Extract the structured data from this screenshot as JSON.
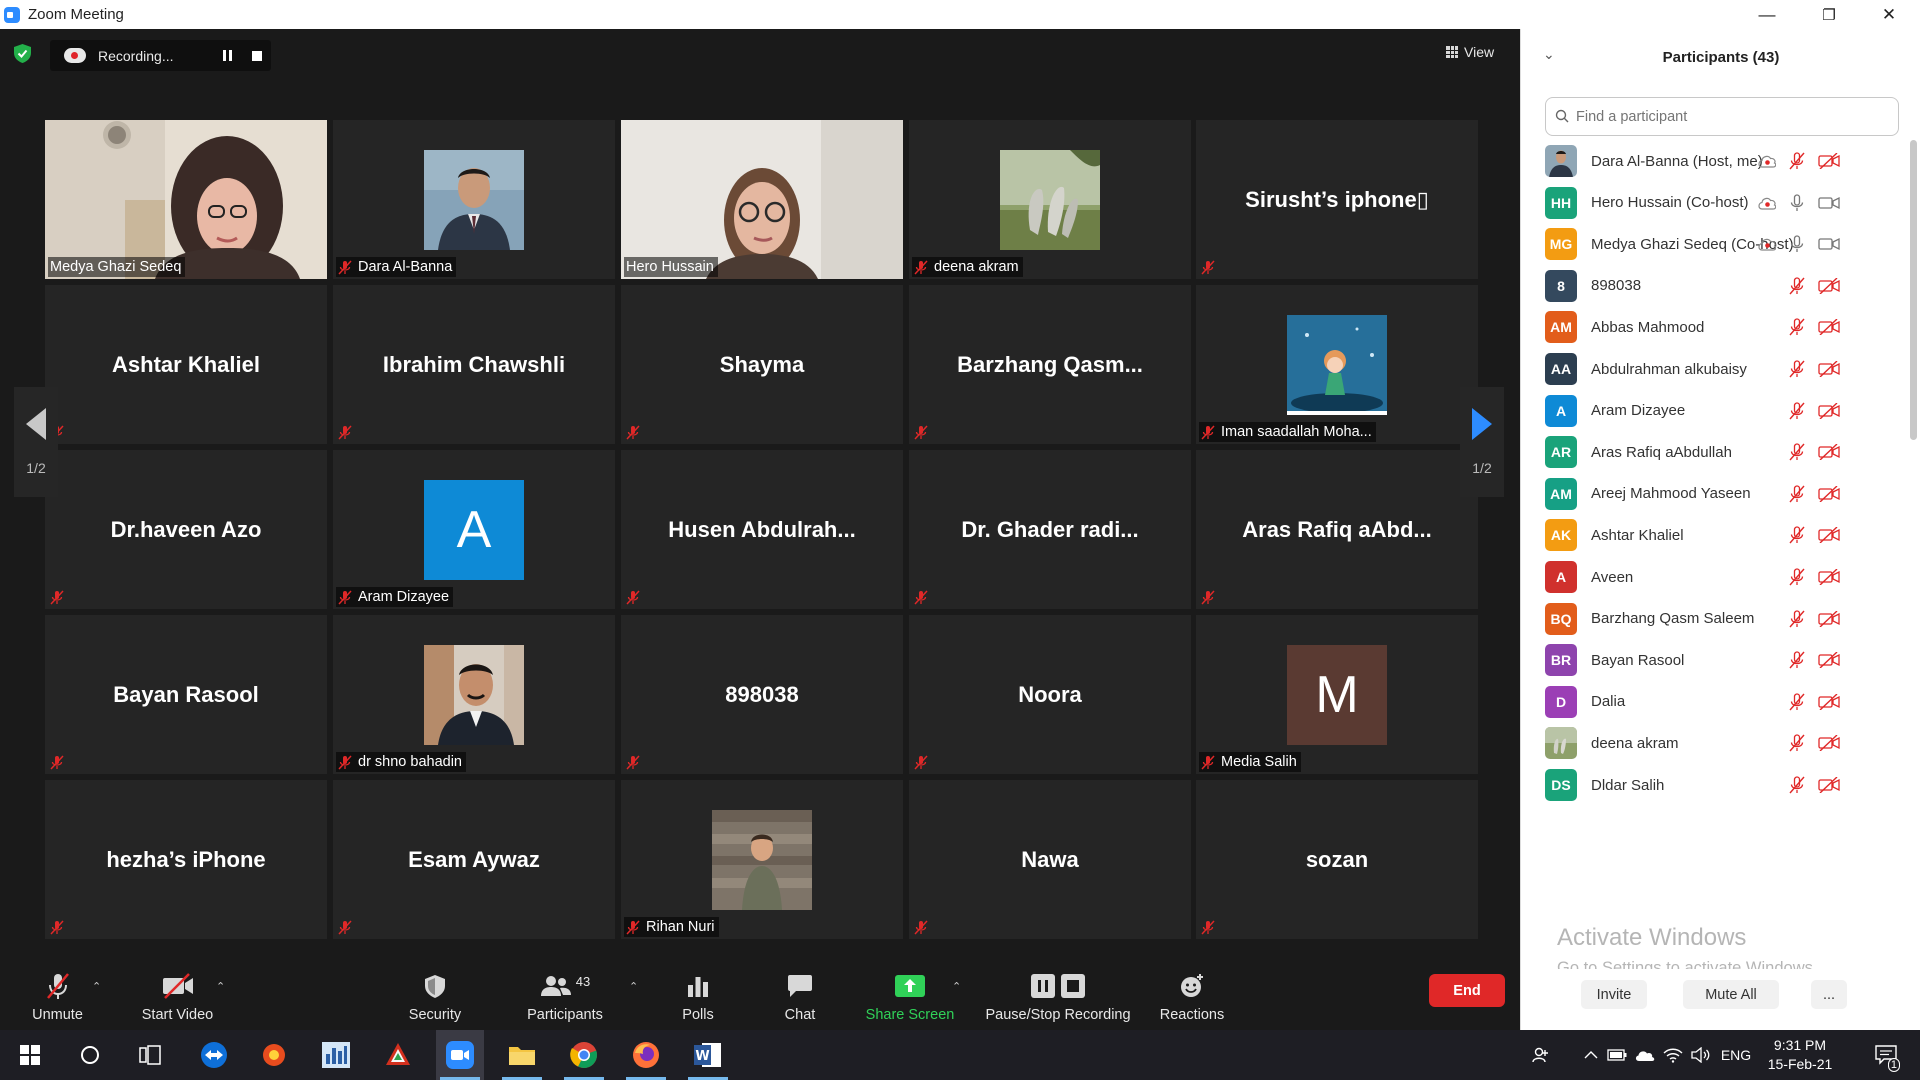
{
  "window": {
    "title": "Zoom Meeting",
    "minimize": "—",
    "restore": "❐",
    "close": "✕"
  },
  "meeting": {
    "recording_label": "Recording...",
    "view_label": "View",
    "page_indicator_left": "1/2",
    "page_indicator_right": "1/2"
  },
  "tiles": [
    {
      "name": "Medya Ghazi Sedeq",
      "kind": "video",
      "muted": false
    },
    {
      "name": "Dara Al-Banna",
      "kind": "photo",
      "muted": true
    },
    {
      "name": "Hero Hussain",
      "kind": "video",
      "muted": false,
      "active": true
    },
    {
      "name": "deena akram",
      "kind": "photo",
      "muted": true
    },
    {
      "name": "Sirusht’s iphone▯",
      "kind": "text",
      "muted": true
    },
    {
      "name": "Ashtar Khaliel",
      "kind": "text",
      "muted": true
    },
    {
      "name": "Ibrahim Chawshli",
      "kind": "text",
      "muted": true
    },
    {
      "name": "Shayma",
      "kind": "text",
      "muted": true
    },
    {
      "name": "Barzhang  Qasm...",
      "kind": "text",
      "muted": true
    },
    {
      "name": "Iman saadallah Moha...",
      "kind": "photo",
      "muted": true
    },
    {
      "name": "Dr.haveen Azo",
      "kind": "text",
      "muted": true
    },
    {
      "name": "Aram Dizayee",
      "kind": "letter",
      "letter": "A",
      "letter_color": "#0e8ad6",
      "muted": true
    },
    {
      "name": "Husen  Abdulrah...",
      "kind": "text",
      "muted": true
    },
    {
      "name": "Dr. Ghader radi...",
      "kind": "text",
      "muted": true
    },
    {
      "name": "Aras Rafiq aAbd...",
      "kind": "text",
      "muted": true
    },
    {
      "name": "Bayan Rasool",
      "kind": "text",
      "muted": true
    },
    {
      "name": "dr shno bahadin",
      "kind": "photo",
      "muted": true
    },
    {
      "name": "898038",
      "kind": "text",
      "muted": true
    },
    {
      "name": "Noora",
      "kind": "text",
      "muted": true
    },
    {
      "name": "Media Salih",
      "kind": "letter",
      "letter": "M",
      "letter_color": "#5a3a32",
      "muted": true
    },
    {
      "name": "hezha’s iPhone",
      "kind": "text",
      "muted": true
    },
    {
      "name": "Esam Aywaz",
      "kind": "text",
      "muted": true
    },
    {
      "name": "Rihan Nuri",
      "kind": "photo",
      "muted": true
    },
    {
      "name": "Nawa",
      "kind": "text",
      "muted": true
    },
    {
      "name": "sozan",
      "kind": "text",
      "muted": true
    }
  ],
  "toolbar": {
    "unmute": "Unmute",
    "start_video": "Start Video",
    "security": "Security",
    "participants": "Participants",
    "participants_count": "43",
    "polls": "Polls",
    "chat": "Chat",
    "share_screen": "Share Screen",
    "pause_stop_recording": "Pause/Stop Recording",
    "reactions": "Reactions",
    "end": "End"
  },
  "panel": {
    "title": "Participants (43)",
    "search_placeholder": "Find a participant",
    "participants": [
      {
        "name": "Dara Al-Banna (Host, me)",
        "initials": "",
        "color": "#6a7a86",
        "photo": true,
        "recording": true,
        "mic": "muted",
        "video": "off"
      },
      {
        "name": "Hero Hussain (Co-host)",
        "initials": "HH",
        "color": "#1aa37a",
        "recording": true,
        "mic": "on",
        "video": "on"
      },
      {
        "name": "Medya Ghazi Sedeq (Co-host)",
        "initials": "MG",
        "color": "#f39c12",
        "recording": true,
        "mic": "on",
        "video": "on"
      },
      {
        "name": "898038",
        "initials": "8",
        "color": "#34495e",
        "mic": "muted",
        "video": "off"
      },
      {
        "name": "Abbas Mahmood",
        "initials": "AM",
        "color": "#e25d1b",
        "mic": "muted",
        "video": "off"
      },
      {
        "name": "Abdulrahman  alkubaisy",
        "initials": "AA",
        "color": "#2c3e50",
        "mic": "muted",
        "video": "off"
      },
      {
        "name": "Aram Dizayee",
        "initials": "A",
        "color": "#0e8ad6",
        "mic": "muted",
        "video": "off"
      },
      {
        "name": "Aras Rafiq aAbdullah",
        "initials": "AR",
        "color": "#1aa37a",
        "mic": "muted",
        "video": "off"
      },
      {
        "name": "Areej Mahmood Yaseen",
        "initials": "AM",
        "color": "#16a085",
        "mic": "muted",
        "video": "off"
      },
      {
        "name": "Ashtar Khaliel",
        "initials": "AK",
        "color": "#f39c12",
        "mic": "muted",
        "video": "off"
      },
      {
        "name": "Aveen",
        "initials": "A",
        "color": "#d0312d",
        "mic": "muted",
        "video": "off"
      },
      {
        "name": "Barzhang Qasm Saleem",
        "initials": "BQ",
        "color": "#e25d1b",
        "mic": "muted",
        "video": "off"
      },
      {
        "name": "Bayan Rasool",
        "initials": "BR",
        "color": "#8e44ad",
        "mic": "muted",
        "video": "off"
      },
      {
        "name": "Dalia",
        "initials": "D",
        "color": "#9b3fb5",
        "mic": "muted",
        "video": "off"
      },
      {
        "name": "deena akram",
        "initials": "",
        "color": "#7d8a6a",
        "photo": true,
        "mic": "muted",
        "video": "off"
      },
      {
        "name": "Dldar Salih",
        "initials": "DS",
        "color": "#1aa37a",
        "mic": "muted",
        "video": "off"
      }
    ],
    "invite": "Invite",
    "mute_all": "Mute All",
    "more": "...",
    "watermark_title": "Activate Windows",
    "watermark_sub": "Go to Settings to activate Windows."
  },
  "taskbar": {
    "language": "ENG",
    "time": "9:31 PM",
    "date": "15-Feb-21",
    "notifications": "1"
  },
  "colors": {
    "accent": "#2d8cff",
    "muted_red": "#e02828",
    "active_border": "#e3e35a",
    "share_green": "#30d158"
  }
}
